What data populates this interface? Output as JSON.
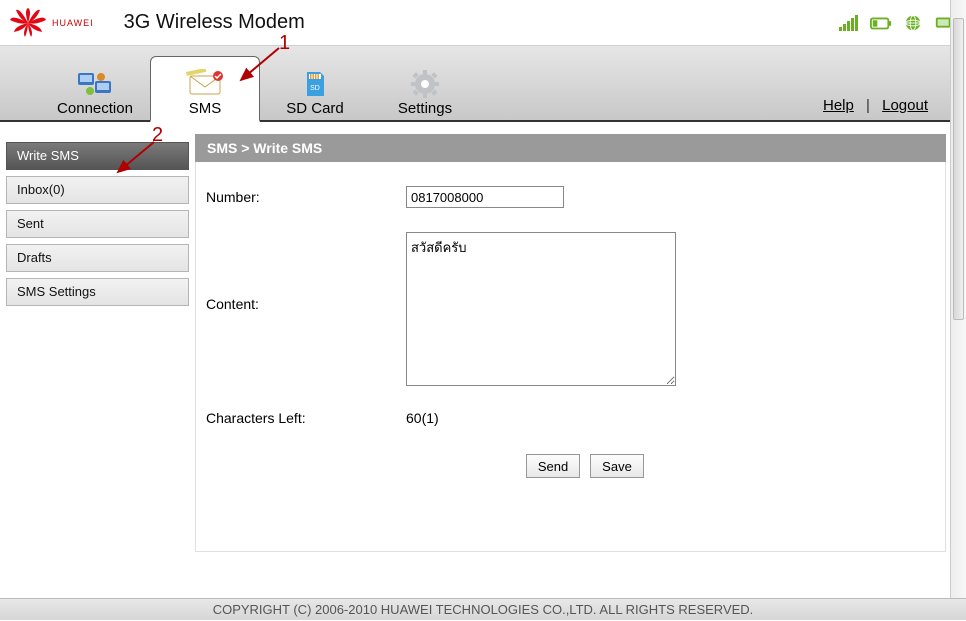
{
  "brand": "HUAWEI",
  "title": "3G Wireless Modem",
  "tabs": {
    "connection": "Connection",
    "sms": "SMS",
    "sdcard": "SD Card",
    "settings": "Settings"
  },
  "links": {
    "help": "Help",
    "logout": "Logout"
  },
  "sidebar": {
    "write": "Write SMS",
    "inbox": "Inbox(0)",
    "sent": "Sent",
    "drafts": "Drafts",
    "settings": "SMS Settings"
  },
  "breadcrumb": "SMS > Write SMS",
  "form": {
    "number_label": "Number:",
    "number_value": "0817008000",
    "content_label": "Content:",
    "content_value": "สวัสดีครับ",
    "chars_label": "Characters Left:",
    "chars_value": "60(1)",
    "send": "Send",
    "save": "Save"
  },
  "footer": "COPYRIGHT (C) 2006-2010 HUAWEI TECHNOLOGIES CO.,LTD. ALL RIGHTS RESERVED.",
  "annotations": {
    "a1": "1",
    "a2": "2"
  }
}
